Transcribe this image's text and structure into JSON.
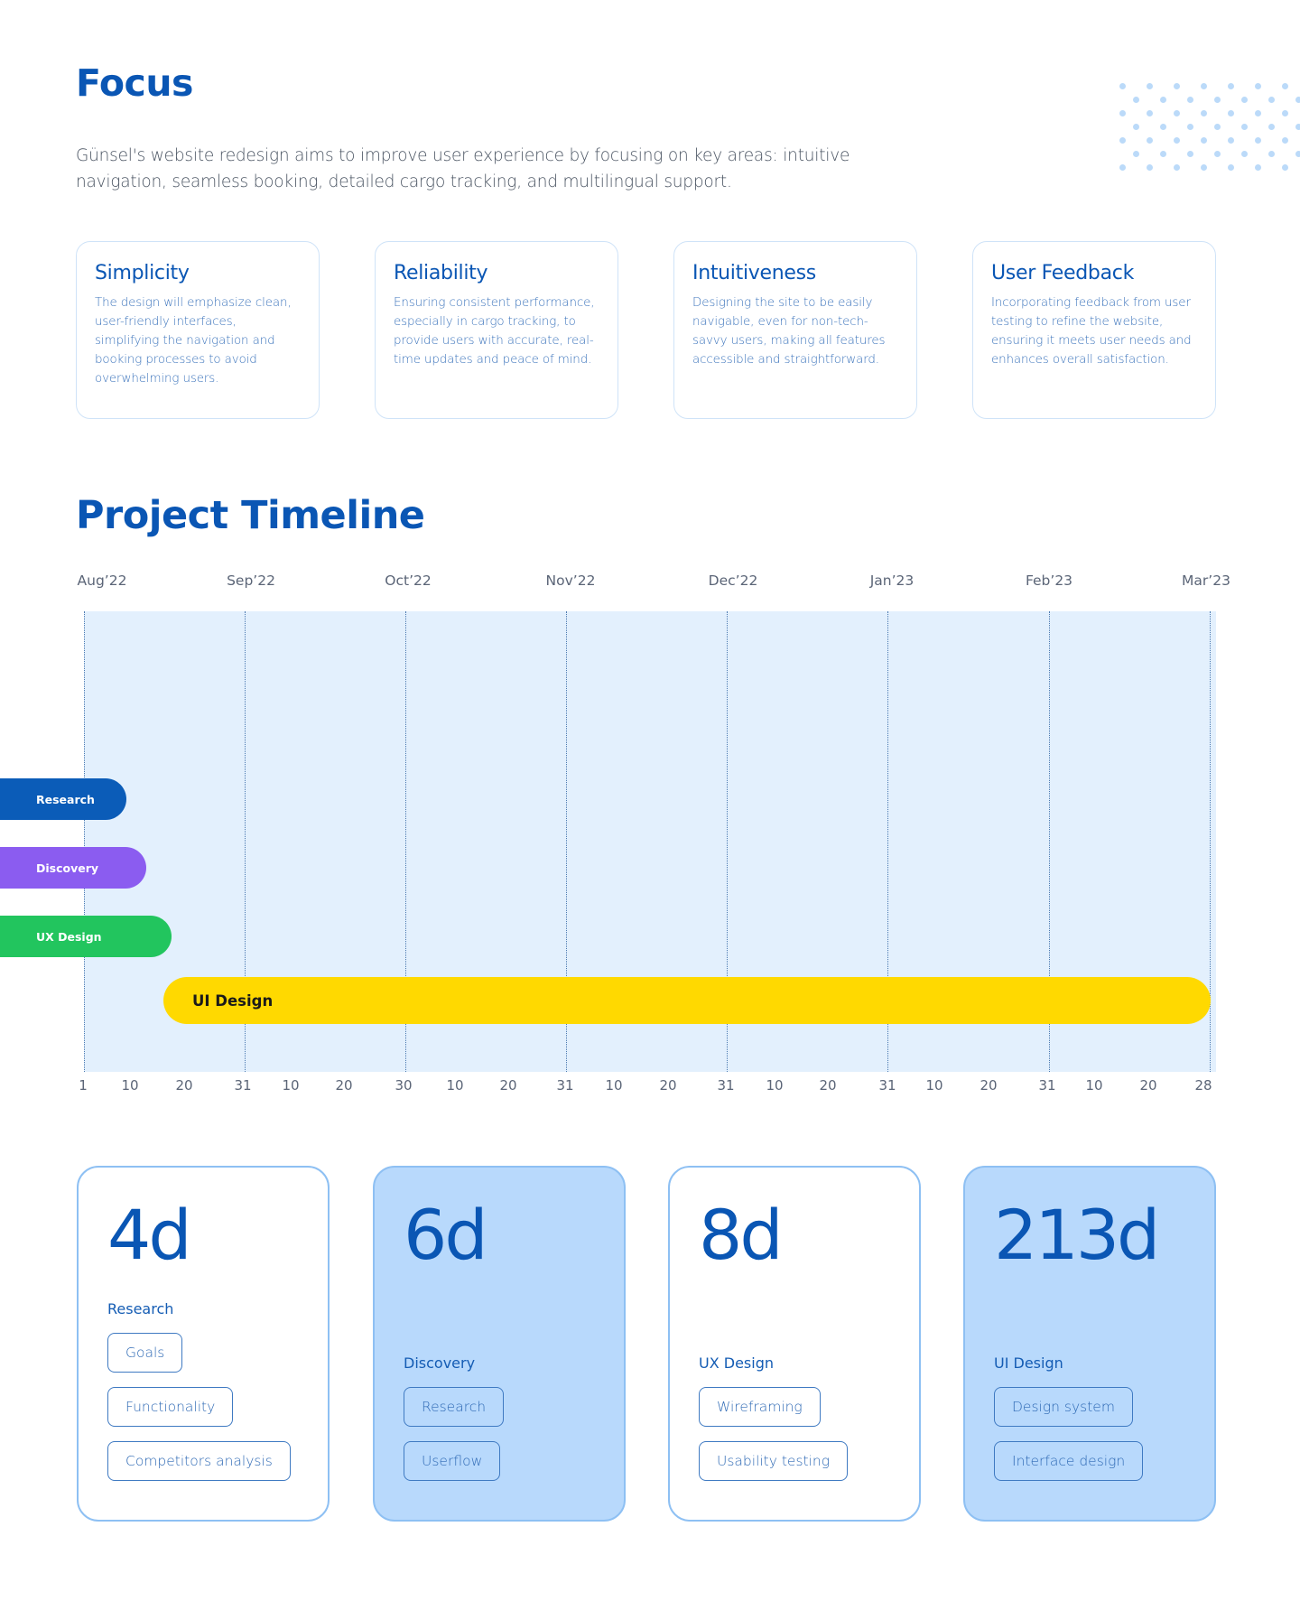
{
  "focus": {
    "title": "Focus",
    "intro": "Günsel's website redesign aims to improve user experience by focusing on key areas: intuitive navigation, seamless booking, detailed cargo tracking, and multilingual support.",
    "cards": [
      {
        "title": "Simplicity",
        "text": "The design will emphasize clean, user-friendly interfaces, simplifying the navigation and booking processes to avoid overwhelming users."
      },
      {
        "title": "Reliability",
        "text": "Ensuring consistent performance, especially in cargo tracking, to provide users with accurate, real-time updates and peace of mind."
      },
      {
        "title": "Intuitiveness",
        "text": "Designing the site to be easily navigable, even for non-tech-savvy users, making all features accessible and straightforward."
      },
      {
        "title": "User Feedback",
        "text": "Incorporating feedback from user testing to refine the website, ensuring it meets user needs and enhances overall satisfaction."
      }
    ],
    "decoration_icon": "dot-grid-icon"
  },
  "timeline": {
    "title": "Project Timeline",
    "months": [
      "Aug’22",
      "Sep’22",
      "Oct’22",
      "Nov’22",
      "Dec’22",
      "Jan’23",
      "Feb’23",
      "Mar’23"
    ],
    "day_ticks": [
      "1",
      "10",
      "20",
      "31",
      "10",
      "20",
      "30",
      "10",
      "20",
      "31",
      "10",
      "20",
      "31",
      "10",
      "20",
      "31",
      "10",
      "20",
      "31",
      "10",
      "20",
      "28"
    ],
    "phases": [
      {
        "label": "Research",
        "color": "#0B5CB8",
        "duration_days": 4
      },
      {
        "label": "Discovery",
        "color": "#8B5CF0",
        "duration_days": 6
      },
      {
        "label": "UX Design",
        "color": "#22C55E",
        "duration_days": 8
      },
      {
        "label": "UI Design",
        "color": "#FFD900",
        "duration_days": 213
      }
    ]
  },
  "summary": [
    {
      "value": "4d",
      "label": "Research",
      "tags": [
        "Goals",
        "Functionality",
        "Competitors analysis"
      ],
      "filled": false
    },
    {
      "value": "6d",
      "label": "Discovery",
      "tags": [
        "Research",
        "Userflow"
      ],
      "filled": true
    },
    {
      "value": "8d",
      "label": "UX Design",
      "tags": [
        "Wireframing",
        "Usability testing"
      ],
      "filled": false
    },
    {
      "value": "213d",
      "label": "UI Design",
      "tags": [
        "Design system",
        "Interface design"
      ],
      "filled": true
    }
  ],
  "colors": {
    "brand_blue": "#0A56B4",
    "timeline_bg": "#E3F0FD",
    "card_fill": "#B8D9FC",
    "card_border": "#8EC0F3"
  }
}
